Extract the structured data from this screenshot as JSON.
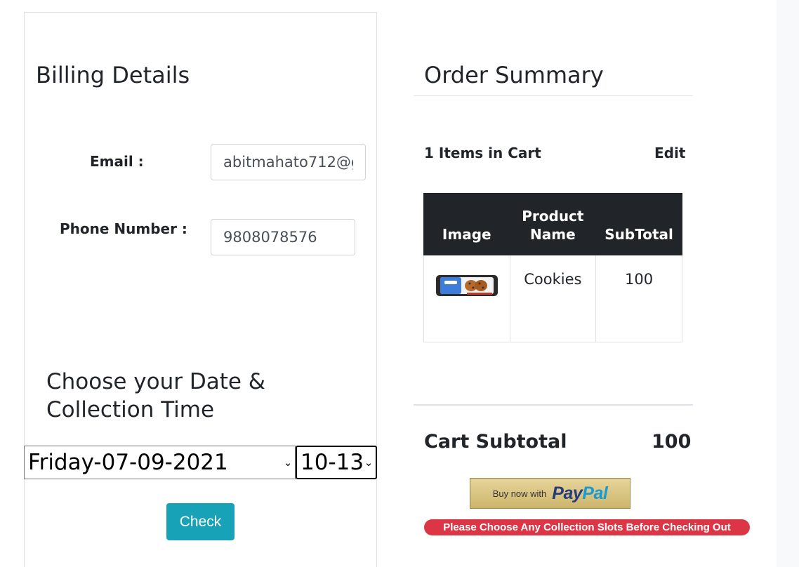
{
  "billing": {
    "title": "Billing Details",
    "email_label": "Email :",
    "email_value": "abitmahato712@g",
    "phone_label": "Phone Number :",
    "phone_value": "9808078576"
  },
  "collection": {
    "title": "Choose your Date & Collection Time",
    "selected_date": "Friday-07-09-2021",
    "selected_time": "10-13",
    "check_label": "Check"
  },
  "order": {
    "title": "Order Summary",
    "items_count_text": "1 Items in Cart",
    "edit_label": "Edit",
    "table": {
      "headers": [
        "Image",
        "Product Name",
        "SubTotal"
      ],
      "rows": [
        {
          "image": "cookies-package",
          "product_name": "Cookies",
          "subtotal": "100"
        }
      ]
    },
    "subtotal_label": "Cart Subtotal",
    "subtotal_value": "100",
    "paypal_prefix": "Buy now with",
    "paypal_brand_1": "Pay",
    "paypal_brand_2": "Pal",
    "warning": "Please Choose Any Collection Slots Before Checking Out"
  },
  "colors": {
    "check_button": "#17a2b8",
    "table_header": "#212529",
    "warning_badge": "#dc3545",
    "paypal_dark": "#253b80",
    "paypal_light": "#179bd7"
  }
}
